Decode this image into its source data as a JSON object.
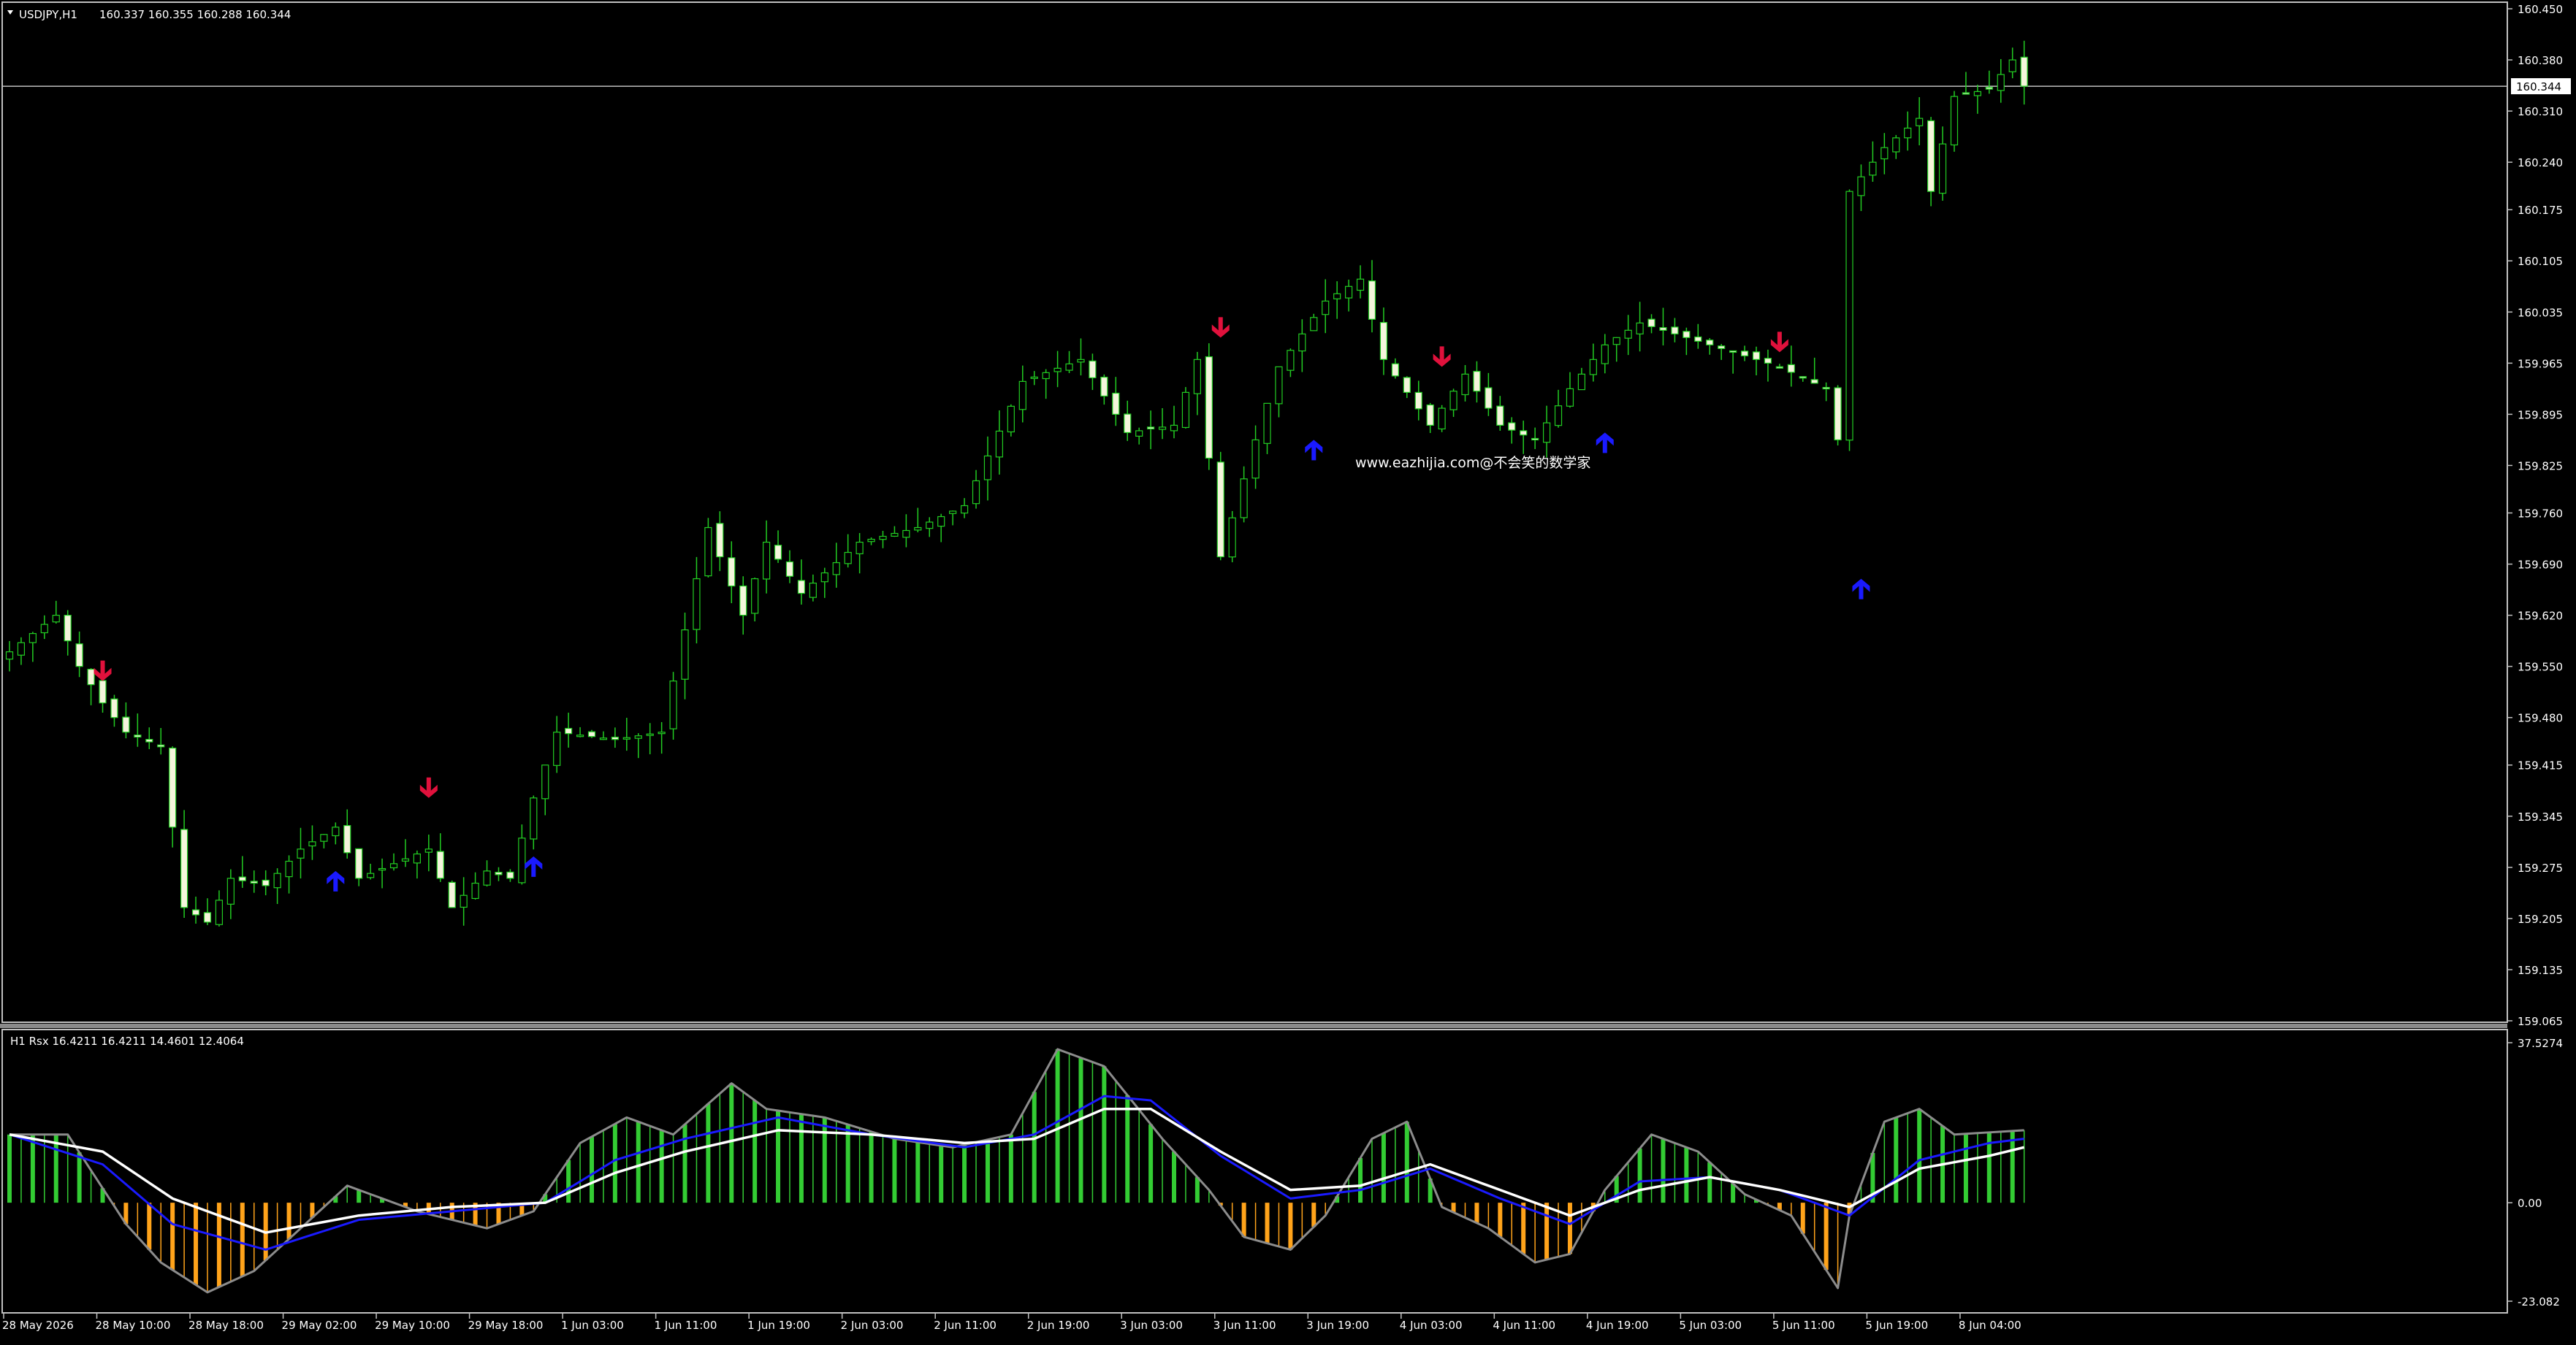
{
  "header": {
    "symbol": "USDJPY,H1",
    "ohlc": "160.337 160.355 160.288 160.344"
  },
  "indicator": {
    "title": "H1 Rsx 16.4211 16.4211 14.4601 12.4064"
  },
  "watermark": "www.eazhijia.com@不会笑的数学家",
  "colors": {
    "background": "#000000",
    "candle_up": "#000000",
    "candle_down": "#f5f5dc",
    "candle_outline": "#22cc22",
    "wick": "#22cc22",
    "grid_line": "#c0c0c0",
    "text": "#ffffff",
    "arrow_down": "#e0113c",
    "arrow_up": "#1a1aff",
    "hist_pos": "#33cc33",
    "hist_neg": "#ffa31a",
    "rsx_line": "#8c8c8c",
    "signal_blue": "#1a1aff",
    "signal_white": "#ffffff"
  },
  "chart_data": [
    {
      "type": "candlestick",
      "symbol": "USDJPY,H1",
      "ylim": [
        159.065,
        160.45
      ],
      "yticks": [
        "160.450",
        "160.380",
        "160.310",
        "160.240",
        "160.175",
        "160.105",
        "160.035",
        "159.965",
        "159.895",
        "159.825",
        "159.760",
        "159.690",
        "159.620",
        "159.550",
        "159.480",
        "159.415",
        "159.345",
        "159.275",
        "159.205",
        "159.135",
        "159.065"
      ],
      "current_price": "160.344",
      "xticks": [
        "28 May 2026",
        "28 May 10:00",
        "28 May 18:00",
        "29 May 02:00",
        "29 May 10:00",
        "29 May 18:00",
        "1 Jun 03:00",
        "1 Jun 11:00",
        "1 Jun 19:00",
        "2 Jun 03:00",
        "2 Jun 11:00",
        "2 Jun 19:00",
        "3 Jun 03:00",
        "3 Jun 11:00",
        "3 Jun 19:00",
        "4 Jun 03:00",
        "4 Jun 11:00",
        "4 Jun 19:00",
        "5 Jun 03:00",
        "5 Jun 11:00",
        "5 Jun 19:00",
        "8 Jun 04:00"
      ],
      "bars_per_tick": 8,
      "close_anchors": [
        [
          0,
          159.57
        ],
        [
          4,
          159.62
        ],
        [
          6,
          159.55
        ],
        [
          8,
          159.5
        ],
        [
          10,
          159.46
        ],
        [
          13,
          159.44
        ],
        [
          15,
          159.22
        ],
        [
          17,
          159.2
        ],
        [
          19,
          159.26
        ],
        [
          22,
          159.25
        ],
        [
          25,
          159.3
        ],
        [
          28,
          159.33
        ],
        [
          30,
          159.26
        ],
        [
          33,
          159.28
        ],
        [
          36,
          159.3
        ],
        [
          38,
          159.22
        ],
        [
          41,
          159.27
        ],
        [
          43,
          159.26
        ],
        [
          45,
          159.37
        ],
        [
          47,
          159.46
        ],
        [
          52,
          159.45
        ],
        [
          56,
          159.46
        ],
        [
          60,
          159.74
        ],
        [
          63,
          159.62
        ],
        [
          65,
          159.72
        ],
        [
          68,
          159.65
        ],
        [
          73,
          159.72
        ],
        [
          78,
          159.74
        ],
        [
          82,
          159.77
        ],
        [
          87,
          159.94
        ],
        [
          92,
          159.97
        ],
        [
          96,
          159.87
        ],
        [
          100,
          159.88
        ],
        [
          102,
          159.97
        ],
        [
          104,
          159.7
        ],
        [
          107,
          159.86
        ],
        [
          109,
          159.96
        ],
        [
          113,
          160.05
        ],
        [
          116,
          160.08
        ],
        [
          118,
          159.97
        ],
        [
          122,
          159.88
        ],
        [
          125,
          159.95
        ],
        [
          128,
          159.88
        ],
        [
          131,
          159.86
        ],
        [
          134,
          159.93
        ],
        [
          137,
          159.99
        ],
        [
          140,
          160.02
        ],
        [
          144,
          160.0
        ],
        [
          148,
          159.98
        ],
        [
          152,
          159.96
        ],
        [
          156,
          159.93
        ],
        [
          157,
          159.86
        ],
        [
          158,
          160.2
        ],
        [
          161,
          160.26
        ],
        [
          164,
          160.3
        ],
        [
          165,
          160.2
        ],
        [
          167,
          160.33
        ],
        [
          170,
          160.34
        ],
        [
          172,
          160.38
        ],
        [
          173,
          160.344
        ]
      ],
      "arrows": [
        {
          "dir": "down",
          "bar": 8,
          "price": 159.53
        },
        {
          "dir": "up",
          "bar": 28,
          "price": 159.27
        },
        {
          "dir": "down",
          "bar": 36,
          "price": 159.37
        },
        {
          "dir": "up",
          "bar": 45,
          "price": 159.29
        },
        {
          "dir": "down",
          "bar": 104,
          "price": 160.0
        },
        {
          "dir": "up",
          "bar": 112,
          "price": 159.86
        },
        {
          "dir": "down",
          "bar": 123,
          "price": 159.96
        },
        {
          "dir": "up",
          "bar": 137,
          "price": 159.87
        },
        {
          "dir": "down",
          "bar": 152,
          "price": 159.98
        },
        {
          "dir": "up",
          "bar": 159,
          "price": 159.67
        }
      ]
    },
    {
      "type": "histogram+line",
      "name": "H1 Rsx",
      "ylim": [
        -23.082,
        37.5274
      ],
      "yticks": [
        "37.5274",
        "0.00",
        "-23.082"
      ],
      "rsx_anchors": [
        [
          0,
          16
        ],
        [
          5,
          16
        ],
        [
          10,
          -5
        ],
        [
          13,
          -14
        ],
        [
          17,
          -21
        ],
        [
          21,
          -16
        ],
        [
          25,
          -6
        ],
        [
          29,
          4
        ],
        [
          31,
          2
        ],
        [
          35,
          -2
        ],
        [
          41,
          -6
        ],
        [
          45,
          -2
        ],
        [
          49,
          14
        ],
        [
          53,
          20
        ],
        [
          57,
          16
        ],
        [
          62,
          28
        ],
        [
          65,
          22
        ],
        [
          70,
          20
        ],
        [
          76,
          15
        ],
        [
          81,
          13
        ],
        [
          86,
          16
        ],
        [
          90,
          36
        ],
        [
          94,
          32
        ],
        [
          99,
          15
        ],
        [
          103,
          3
        ],
        [
          106,
          -8
        ],
        [
          110,
          -11
        ],
        [
          113,
          -3
        ],
        [
          117,
          15
        ],
        [
          120,
          19
        ],
        [
          123,
          -1
        ],
        [
          127,
          -6
        ],
        [
          131,
          -14
        ],
        [
          134,
          -12
        ],
        [
          137,
          3
        ],
        [
          141,
          16
        ],
        [
          145,
          12
        ],
        [
          149,
          2
        ],
        [
          153,
          -3
        ],
        [
          157,
          -20
        ],
        [
          158,
          -3
        ],
        [
          161,
          19
        ],
        [
          164,
          22
        ],
        [
          167,
          16
        ],
        [
          173,
          17
        ]
      ],
      "signal_blue_anchors": [
        [
          0,
          16
        ],
        [
          8,
          9
        ],
        [
          14,
          -5
        ],
        [
          22,
          -11
        ],
        [
          30,
          -4
        ],
        [
          38,
          -2
        ],
        [
          46,
          0
        ],
        [
          52,
          10
        ],
        [
          58,
          15
        ],
        [
          66,
          20
        ],
        [
          74,
          16
        ],
        [
          82,
          13
        ],
        [
          88,
          16
        ],
        [
          94,
          25
        ],
        [
          98,
          24
        ],
        [
          104,
          11
        ],
        [
          110,
          1
        ],
        [
          116,
          3
        ],
        [
          122,
          8
        ],
        [
          128,
          1
        ],
        [
          134,
          -5
        ],
        [
          140,
          5
        ],
        [
          146,
          6
        ],
        [
          152,
          3
        ],
        [
          158,
          -3
        ],
        [
          164,
          10
        ],
        [
          170,
          14
        ],
        [
          173,
          15
        ]
      ],
      "signal_white_anchors": [
        [
          0,
          16
        ],
        [
          8,
          12
        ],
        [
          14,
          1
        ],
        [
          22,
          -7
        ],
        [
          30,
          -3
        ],
        [
          38,
          -1
        ],
        [
          46,
          0
        ],
        [
          52,
          7
        ],
        [
          58,
          12
        ],
        [
          66,
          17
        ],
        [
          74,
          16
        ],
        [
          82,
          14
        ],
        [
          88,
          15
        ],
        [
          94,
          22
        ],
        [
          98,
          22
        ],
        [
          104,
          12
        ],
        [
          110,
          3
        ],
        [
          116,
          4
        ],
        [
          122,
          9
        ],
        [
          128,
          3
        ],
        [
          134,
          -3
        ],
        [
          140,
          3
        ],
        [
          146,
          6
        ],
        [
          152,
          3
        ],
        [
          158,
          -1
        ],
        [
          164,
          8
        ],
        [
          170,
          11
        ],
        [
          173,
          13
        ]
      ]
    }
  ]
}
